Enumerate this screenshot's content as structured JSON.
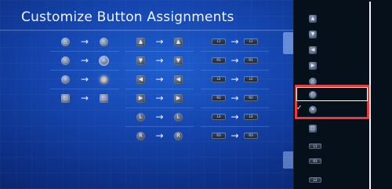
{
  "title": "Customize Button Assignments",
  "arrow": "→",
  "group1": [
    {
      "from": "△",
      "to": "△"
    },
    {
      "from": "○",
      "to": "✕"
    },
    {
      "from": "✕",
      "to": "○"
    },
    {
      "from": "□",
      "to": "□"
    }
  ],
  "group2": [
    {
      "from": "▲",
      "to": "▲"
    },
    {
      "from": "▼",
      "to": "▼"
    },
    {
      "from": "◀",
      "to": "◀"
    },
    {
      "from": "▶",
      "to": "▶"
    },
    {
      "from": "L",
      "to": "L"
    },
    {
      "from": "R",
      "to": "R"
    }
  ],
  "group3": [
    {
      "from": "L1",
      "to": "L1"
    },
    {
      "from": "R1",
      "to": "R1"
    },
    {
      "from": "L2",
      "to": "L2"
    },
    {
      "from": "R2",
      "to": "R2"
    },
    {
      "from": "L3",
      "to": "L3"
    },
    {
      "from": "R3",
      "to": "R3"
    }
  ],
  "sidebar_items": [
    {
      "label": "▲"
    },
    {
      "label": "▼"
    },
    {
      "label": "◀"
    },
    {
      "label": "▶"
    },
    {
      "label": "△"
    },
    {
      "label": "○"
    },
    {
      "label": "✕"
    },
    {
      "label": "□"
    },
    {
      "label": "L1"
    },
    {
      "label": "R1"
    },
    {
      "label": "L2"
    }
  ],
  "checkmark": "✓",
  "colors": {
    "highlight": "#ea3a3c",
    "background": "#1546b0",
    "sidebar": "#06101b"
  }
}
